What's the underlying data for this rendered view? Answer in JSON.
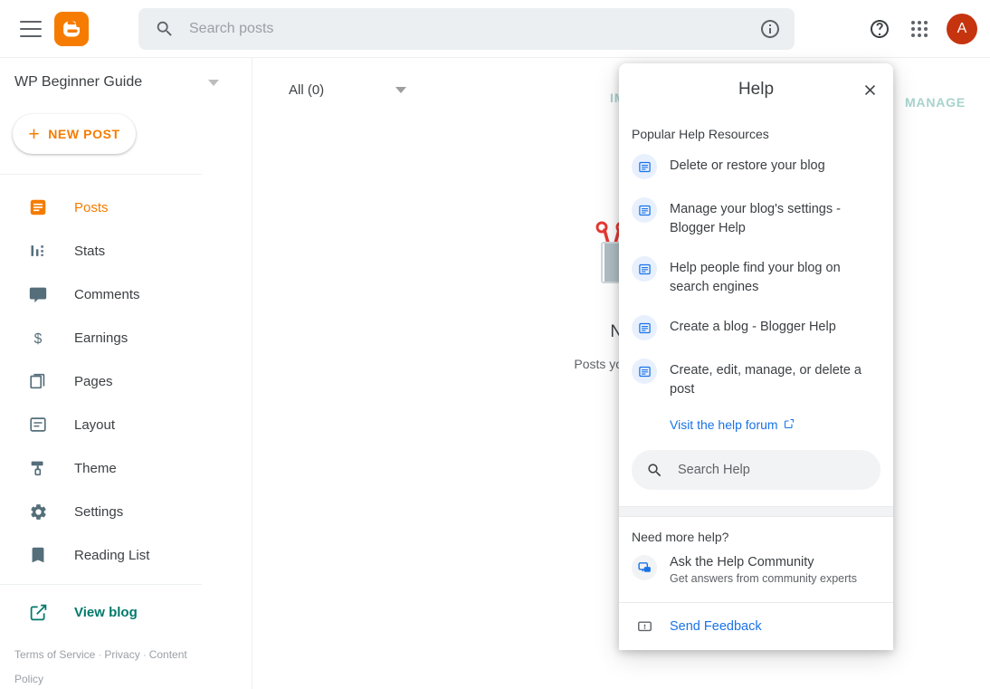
{
  "topbar": {
    "menu_icon": "hamburger-menu-icon",
    "logo_icon": "blogger-logo-icon",
    "search": {
      "placeholder": "Search posts",
      "value": "",
      "icon": "search-icon"
    },
    "info_icon": "info-icon",
    "help_icon": "help-circle-icon",
    "apps_icon": "apps-grid-icon",
    "avatar_initial": "A"
  },
  "sidebar": {
    "blog_title": "WP Beginner Guide",
    "blog_dropdown_icon": "chevron-down-icon",
    "new_post_label": "NEW POST",
    "new_post_icon": "plus-icon",
    "items": [
      {
        "label": "Posts",
        "icon": "posts-icon",
        "active": true
      },
      {
        "label": "Stats",
        "icon": "stats-bar-chart-icon",
        "active": false
      },
      {
        "label": "Comments",
        "icon": "comment-bubble-icon",
        "active": false
      },
      {
        "label": "Earnings",
        "icon": "dollar-sign-icon",
        "active": false
      },
      {
        "label": "Pages",
        "icon": "pages-copy-icon",
        "active": false
      },
      {
        "label": "Layout",
        "icon": "layout-icon",
        "active": false
      },
      {
        "label": "Theme",
        "icon": "paint-roller-icon",
        "active": false
      },
      {
        "label": "Settings",
        "icon": "gear-icon",
        "active": false
      },
      {
        "label": "Reading List",
        "icon": "bookmark-icon",
        "active": false
      }
    ],
    "view_blog": {
      "label": "View blog",
      "icon": "open-in-new-icon"
    },
    "footer_links": [
      "Terms of Service",
      "Privacy",
      "Content Policy"
    ],
    "footer_separator": "·"
  },
  "main": {
    "filter_label": "All (0)",
    "filter_icon": "chevron-down-icon",
    "import_label": "IMPORT",
    "manage_label": "MANAGE",
    "empty_state": {
      "illustration": "pencil-cup-illustration",
      "title": "No",
      "subtitle": "Posts you create"
    }
  },
  "help_panel": {
    "title": "Help",
    "close_icon": "close-icon",
    "section_title": "Popular Help Resources",
    "resources": [
      {
        "label": "Delete or restore your blog",
        "icon": "article-icon"
      },
      {
        "label": "Manage your blog's settings - Blogger Help",
        "icon": "article-icon"
      },
      {
        "label": "Help people find your blog on search engines",
        "icon": "article-icon"
      },
      {
        "label": "Create a blog - Blogger Help",
        "icon": "article-icon"
      },
      {
        "label": "Create, edit, manage, or delete a post",
        "icon": "article-icon"
      }
    ],
    "forum_link": {
      "label": "Visit the help forum",
      "icon": "open-in-new-icon"
    },
    "search": {
      "placeholder": "Search Help",
      "value": "",
      "icon": "search-icon"
    },
    "need_more_help_title": "Need more help?",
    "community": {
      "title": "Ask the Help Community",
      "subtitle": "Get answers from community experts",
      "icon": "community-chat-icon"
    },
    "feedback": {
      "label": "Send Feedback",
      "icon": "feedback-icon"
    }
  },
  "colors": {
    "brand_orange": "#f57c00",
    "teal": "#00796b",
    "link_blue": "#1a73e8",
    "avatar_red": "#c5340f",
    "muted_teal": "#a7d3cd"
  }
}
